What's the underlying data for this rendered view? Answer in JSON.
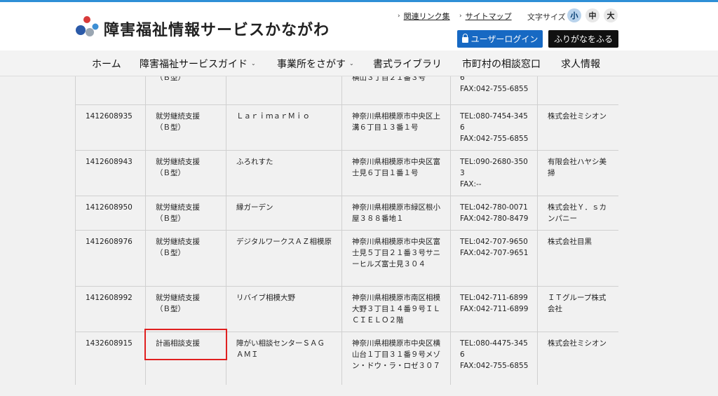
{
  "header": {
    "site_title": "障害福祉情報サービスかながわ",
    "logo_icon": "colored-spheres-logo-icon",
    "links": {
      "related_links": "関連リンク集",
      "sitemap": "サイトマップ"
    },
    "font_size": {
      "label": "文字サイズ",
      "small": "小",
      "medium": "中",
      "large": "大",
      "selected": "小"
    },
    "login_label": "ユーザーログイン",
    "furigana_label": "ふりがなをふる"
  },
  "nav": {
    "home": "ホーム",
    "service_guide": "障害福祉サービスガイド",
    "find_office": "事業所をさがす",
    "forms_library": "書式ライブラリ",
    "consultation": "市町村の相談窓口",
    "jobs": "求人情報"
  },
  "table": {
    "rows": [
      {
        "no": "",
        "service": "（Ｂ型）",
        "name": "",
        "address": "横山３丁目２１番３号",
        "tel": "6\nFAX:042-755-6855",
        "corp": ""
      },
      {
        "no": "1412608935",
        "service": "就労継続支援\n（Ｂ型）",
        "name": "ＬａｒｉｍａｒＭｉｏ",
        "address": "神奈川県相模原市中央区上溝６丁目１３番１号",
        "tel": "TEL:080-7454-345\n6\nFAX:042-755-6855",
        "corp": "株式会社ミシオン"
      },
      {
        "no": "1412608943",
        "service": "就労継続支援\n（Ｂ型）",
        "name": "ふろれすた",
        "address": "神奈川県相模原市中央区富士見６丁目１番１号",
        "tel": "TEL:090-2680-350\n3\nFAX:--",
        "corp": "有限会社ハヤシ美掃"
      },
      {
        "no": "1412608950",
        "service": "就労継続支援\n（Ｂ型）",
        "name": "縁ガーデン",
        "address": "神奈川県相模原市緑区根小屋３８８番地１",
        "tel": "TEL:042-780-0071\nFAX:042-780-8479",
        "corp": "株式会社Ｙ．ｓカンパニー"
      },
      {
        "no": "1412608976",
        "service": "就労継続支援\n（Ｂ型）",
        "name": "デジタルワークスＡＺ相模原",
        "address": "神奈川県相模原市中央区富士見５丁目２１番３号サニーヒルズ富士見３０４",
        "tel": "TEL:042-707-9650\nFAX:042-707-9651",
        "corp": "株式会社目黒"
      },
      {
        "no": "1412608992",
        "service": "就労継続支援\n（Ｂ型）",
        "name": "リバイブ相模大野",
        "address": "神奈川県相模原市南区相模大野３丁目１４番９号ＩＬ　ＣＩＥＬＯ２階",
        "tel": "TEL:042-711-6899\nFAX:042-711-6899",
        "corp": "ＩＴグループ株式会社"
      },
      {
        "no": "1432608915",
        "service": "計画相談支援",
        "name": "障がい相談センターＳＡＧＡＭＩ",
        "address": "神奈川県相模原市中央区横山台１丁目３１番９号メゾン・ドウ・ラ・ロゼ３０７",
        "tel": "TEL:080-4475-345\n6\nFAX:042-755-6855",
        "corp": "株式会社ミシオン"
      }
    ]
  },
  "colors": {
    "accent_blue": "#1769c3",
    "highlight_red": "#e02020",
    "topline": "#2e8fd6"
  }
}
